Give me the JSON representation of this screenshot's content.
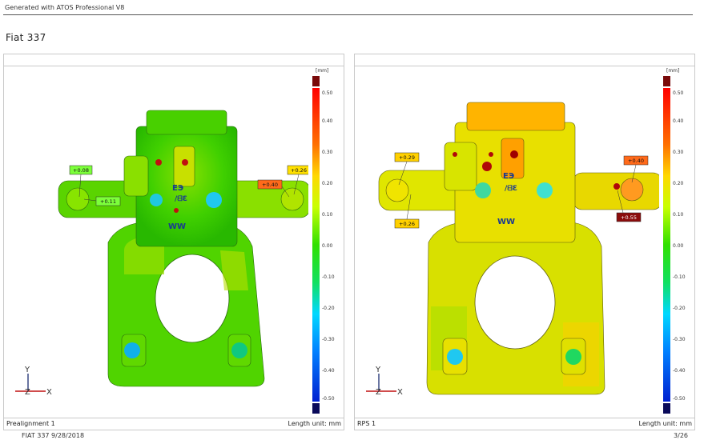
{
  "header": {
    "generator": "Generated with ATOS Professional V8",
    "title": "Fiat 337"
  },
  "colors": {
    "scale_top": "#7a0a0a",
    "scale_bottom": "#0a0a5a",
    "border": "#c9c9c9"
  },
  "colorbar": {
    "unit": "[mm]",
    "ticks": [
      "0.50",
      "0.40",
      "0.30",
      "0.20",
      "0.10",
      "0.00",
      "-0.10",
      "-0.20",
      "-0.30",
      "-0.40",
      "-0.50"
    ]
  },
  "panels": [
    {
      "footer_left": "Prealignment 1",
      "footer_right": "Length unit: mm",
      "labels": [
        {
          "text": "+0.08",
          "color": "#7cff3a"
        },
        {
          "text": "+0.11",
          "color": "#7cff3a"
        },
        {
          "text": "+0.40",
          "color": "#ff6a1a"
        },
        {
          "text": "+0.26",
          "color": "#ffe000"
        }
      ],
      "axes": {
        "y": "Y",
        "x": "X",
        "z": "Z"
      }
    },
    {
      "footer_left": "RPS 1",
      "footer_right": "Length unit: mm",
      "labels": [
        {
          "text": "+0.29",
          "color": "#ffd000"
        },
        {
          "text": "+0.26",
          "color": "#ffd000"
        },
        {
          "text": "+0.40",
          "color": "#ff6a1a"
        },
        {
          "text": "+0.55",
          "color": "#8b0c0c"
        }
      ],
      "axes": {
        "y": "Y",
        "x": "X",
        "z": "Z"
      }
    }
  ],
  "footer": {
    "left": "FIAT 337  9/28/2018",
    "right": "3/26"
  }
}
